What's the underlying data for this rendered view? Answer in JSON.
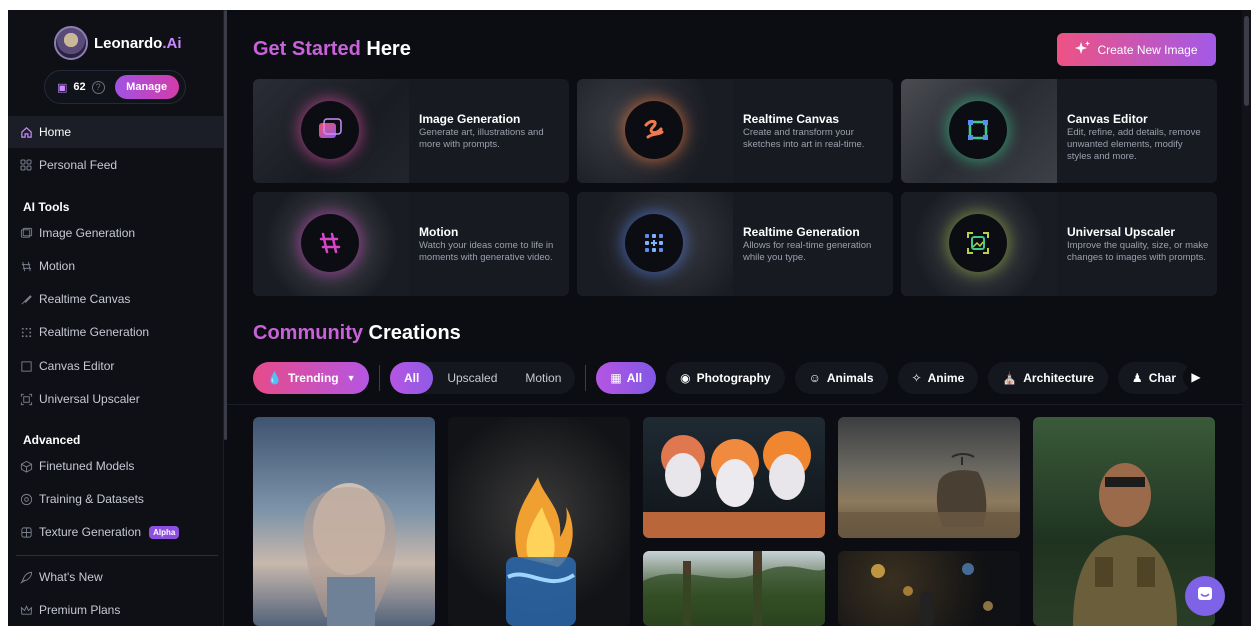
{
  "brand": {
    "name": "Leonardo",
    "suffix": ".Ai"
  },
  "tokens": {
    "count": "62",
    "help": "?",
    "manage_label": "Manage"
  },
  "nav": {
    "home": "Home",
    "personal_feed": "Personal Feed",
    "ai_tools_heading": "AI Tools",
    "image_generation": "Image Generation",
    "motion": "Motion",
    "realtime_canvas": "Realtime Canvas",
    "realtime_generation": "Realtime Generation",
    "canvas_editor": "Canvas Editor",
    "universal_upscaler": "Universal Upscaler",
    "advanced_heading": "Advanced",
    "finetuned_models": "Finetuned Models",
    "training_datasets": "Training & Datasets",
    "texture_generation": "Texture Generation",
    "alpha_badge": "Alpha",
    "whats_new": "What's New",
    "premium_plans": "Premium Plans"
  },
  "get_started": {
    "title_a": "Get Started",
    "title_b": " Here",
    "create_label": "Create New Image"
  },
  "cards": [
    {
      "title": "Image Generation",
      "desc": "Generate art, illustrations and more with prompts."
    },
    {
      "title": "Realtime Canvas",
      "desc": "Create and transform your sketches into art in real-time."
    },
    {
      "title": "Canvas Editor",
      "desc": "Edit, refine, add details, remove unwanted elements, modify styles and more."
    },
    {
      "title": "Motion",
      "desc": "Watch your ideas come to life in moments with generative video."
    },
    {
      "title": "Realtime Generation",
      "desc": "Allows for real-time generation while you type."
    },
    {
      "title": "Universal Upscaler",
      "desc": "Improve the quality, size, or make changes to images with prompts."
    }
  ],
  "community": {
    "title_a": "Community",
    "title_b": " Creations"
  },
  "filters": {
    "trending": "Trending",
    "all": "All",
    "upscaled": "Upscaled",
    "motion": "Motion",
    "cat_all": "All",
    "photography": "Photography",
    "animals": "Animals",
    "anime": "Anime",
    "architecture": "Architecture",
    "character": "Char"
  },
  "colors": {
    "accent": "#c762d8",
    "create_start": "#ee5283",
    "create_end": "#a25ae8",
    "chat": "#7e63e6"
  }
}
